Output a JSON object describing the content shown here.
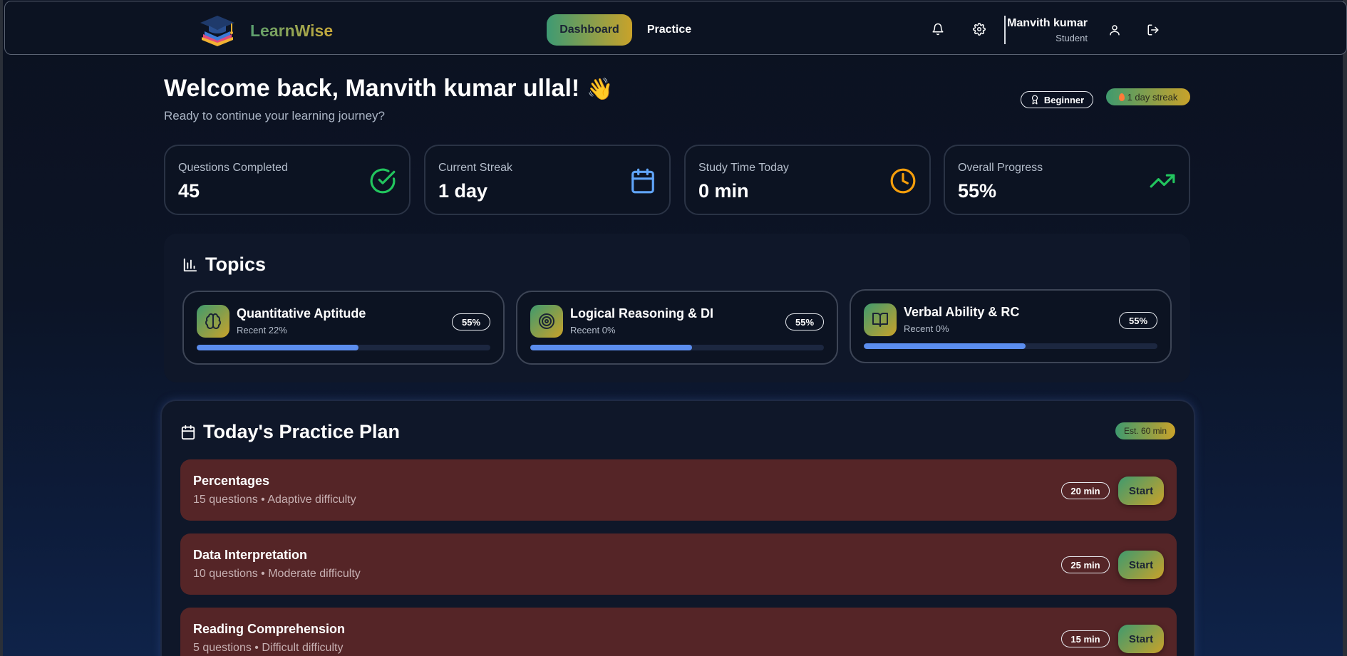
{
  "brand": {
    "name": "LearnWise"
  },
  "nav": {
    "tabs": [
      {
        "label": "Dashboard",
        "active": true
      },
      {
        "label": "Practice",
        "active": false
      }
    ]
  },
  "header_icons": [
    "bell-icon",
    "gear-icon",
    "user-icon",
    "logout-icon"
  ],
  "user": {
    "name": "Manvith kumar",
    "role": "Student"
  },
  "welcome": {
    "title": "Welcome back, Manvith kumar ullal!",
    "emoji": "👋",
    "subtitle": "Ready to continue your learning journey?"
  },
  "badges": {
    "level": "Beginner",
    "streak": "1 day streak"
  },
  "stats": [
    {
      "label": "Questions Completed",
      "value": "45",
      "icon": "check-circle-icon",
      "color": "#22c55e"
    },
    {
      "label": "Current Streak",
      "value": "1 day",
      "icon": "calendar-icon",
      "color": "#60a5fa"
    },
    {
      "label": "Study Time Today",
      "value": "0 min",
      "icon": "clock-icon",
      "color": "#f59e0b"
    },
    {
      "label": "Overall Progress",
      "value": "55%",
      "icon": "trending-up-icon",
      "color": "#22c55e"
    }
  ],
  "topics": {
    "title": "Topics",
    "items": [
      {
        "name": "Quantitative Aptitude",
        "recent": "Recent 22%",
        "percent": "55%",
        "progress": 0.55,
        "icon": "brain-icon"
      },
      {
        "name": "Logical Reasoning & DI",
        "recent": "Recent 0%",
        "percent": "55%",
        "progress": 0.55,
        "icon": "target-icon"
      },
      {
        "name": "Verbal Ability & RC",
        "recent": "Recent 0%",
        "percent": "55%",
        "progress": 0.55,
        "icon": "book-open-icon"
      }
    ]
  },
  "plan": {
    "title": "Today's Practice Plan",
    "estimate": "Est. 60 min",
    "items": [
      {
        "title": "Percentages",
        "subtitle": "15 questions • Adaptive difficulty",
        "time": "20 min",
        "action": "Start"
      },
      {
        "title": "Data Interpretation",
        "subtitle": "10 questions • Moderate difficulty",
        "time": "25 min",
        "action": "Start"
      },
      {
        "title": "Reading Comprehension",
        "subtitle": "5 questions • Difficult difficulty",
        "time": "15 min",
        "action": "Start"
      }
    ]
  },
  "colors": {
    "accent_gradient_start": "#3f9a6e",
    "accent_gradient_end": "#c9a22a",
    "progress_fill": "#5b8dee",
    "plan_item_bg": "#552527"
  }
}
